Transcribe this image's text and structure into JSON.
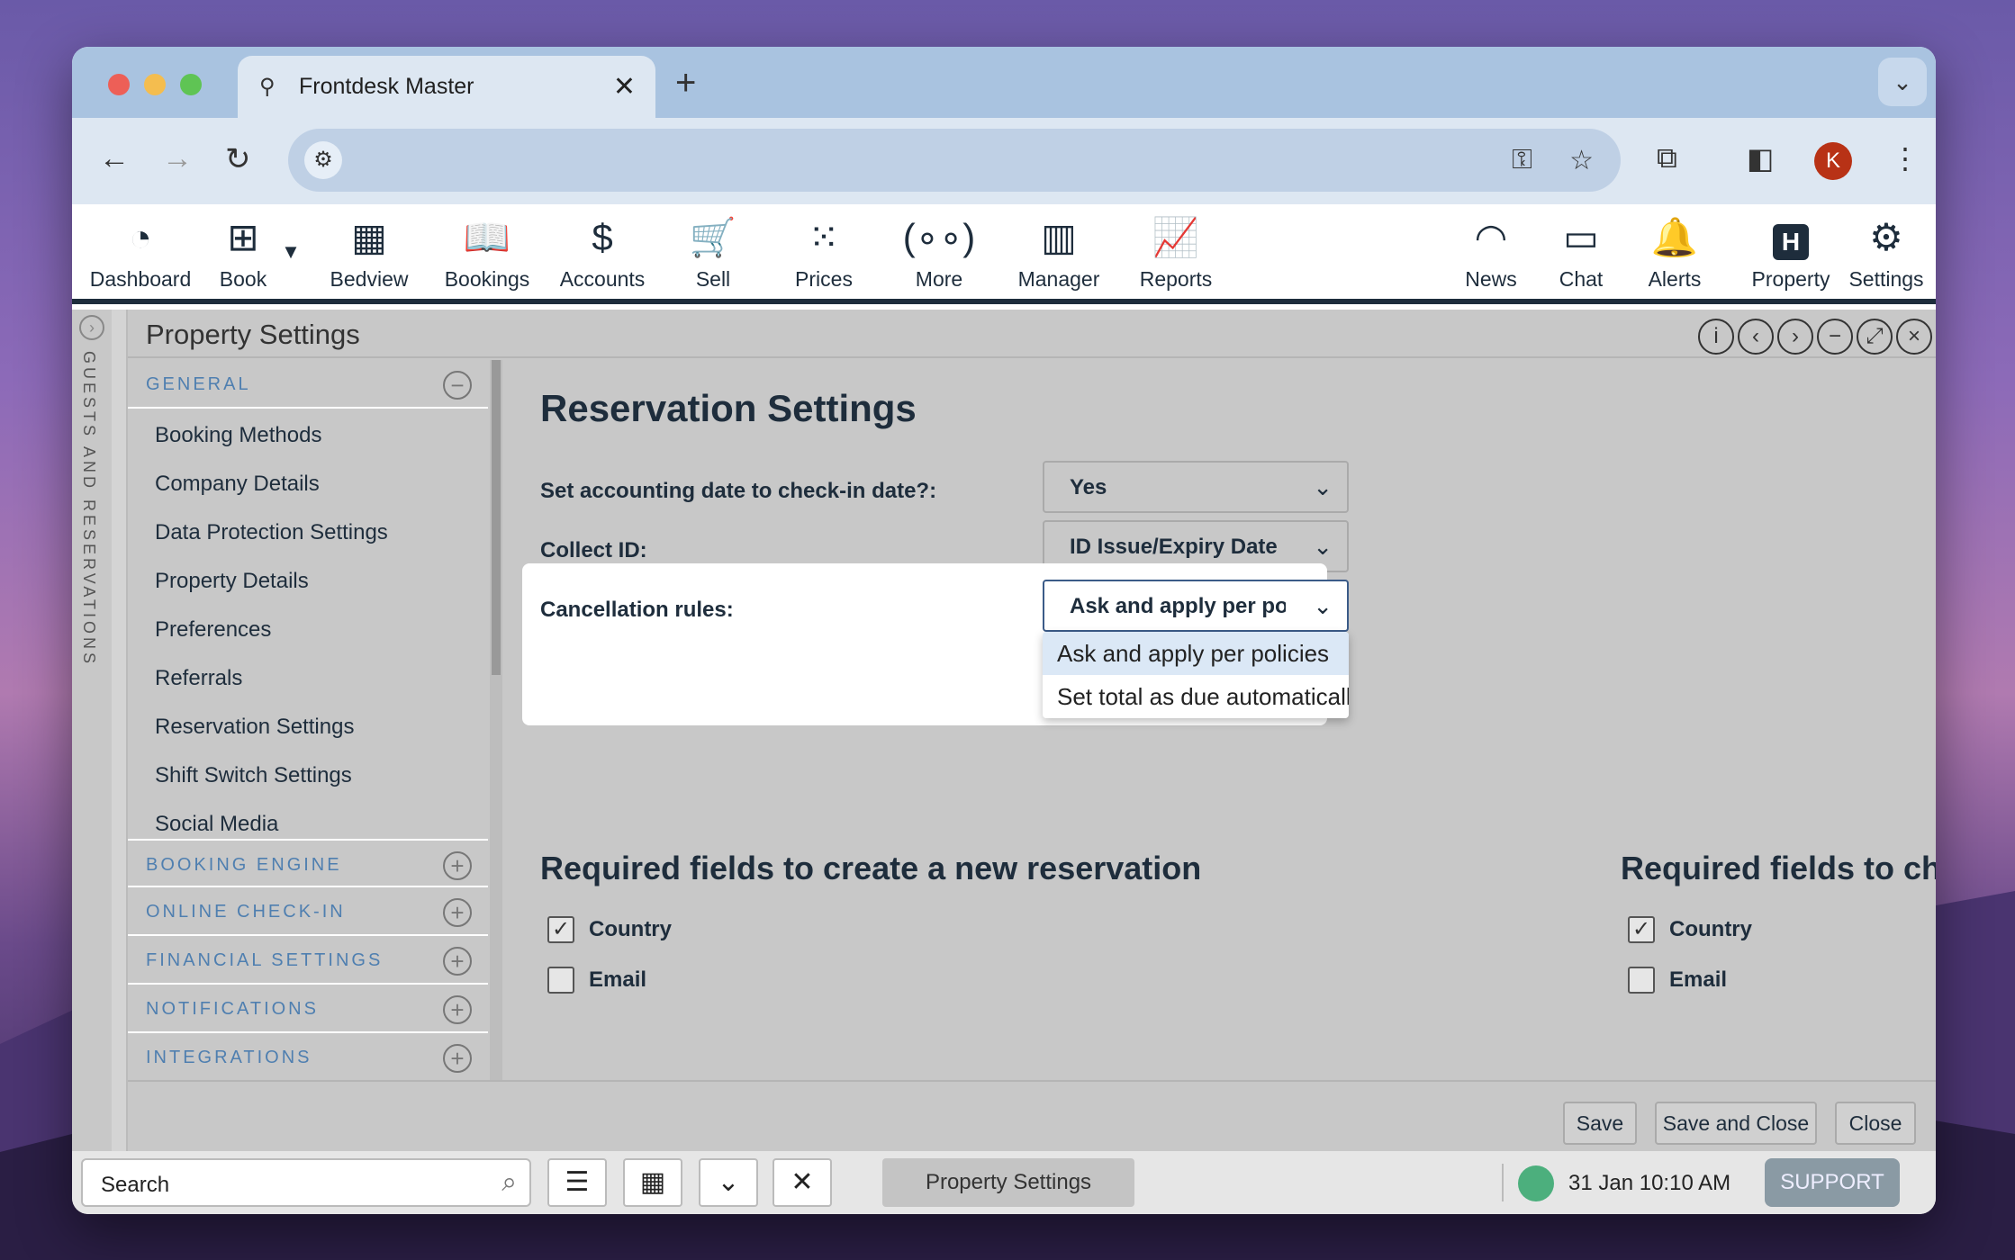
{
  "browser": {
    "tab_title": "Frontdesk Master",
    "new_tab_symbol": "+",
    "avatar_letter": "K"
  },
  "appnav": {
    "items": [
      {
        "label": "Dashboard",
        "icon": "dashboard-gauge-icon"
      },
      {
        "label": "Book",
        "icon": "plus-square-icon"
      },
      {
        "label": "Bedview",
        "icon": "grid-icon"
      },
      {
        "label": "Bookings",
        "icon": "book-open-icon"
      },
      {
        "label": "Accounts",
        "icon": "accounts-dollar-icon"
      },
      {
        "label": "Sell",
        "icon": "cart-icon"
      },
      {
        "label": "Prices",
        "icon": "dots-grid-icon"
      },
      {
        "label": "More",
        "icon": "more-icon"
      },
      {
        "label": "Manager",
        "icon": "building-icon"
      },
      {
        "label": "Reports",
        "icon": "chart-icon"
      },
      {
        "label": "News",
        "icon": "rss-icon"
      },
      {
        "label": "Chat",
        "icon": "chat-icon"
      },
      {
        "label": "Alerts",
        "icon": "bell-icon"
      },
      {
        "label": "Property",
        "icon": "hotel-h-icon"
      },
      {
        "label": "Settings",
        "icon": "gear-icon"
      }
    ]
  },
  "side_strip_label": "GUESTS AND RESERVATIONS",
  "panel": {
    "title": "Property Settings"
  },
  "leftmenu": {
    "general": "GENERAL",
    "items": [
      "Booking Methods",
      "Company Details",
      "Data Protection Settings",
      "Property Details",
      "Preferences",
      "Referrals",
      "Reservation Settings",
      "Shift Switch Settings",
      "Social Media"
    ],
    "sections": [
      "BOOKING ENGINE",
      "ONLINE CHECK-IN",
      "FINANCIAL SETTINGS",
      "NOTIFICATIONS",
      "INTEGRATIONS"
    ]
  },
  "main": {
    "heading": "Reservation Settings",
    "fields": [
      {
        "label": "Set accounting date to check-in date?:",
        "value": "Yes"
      },
      {
        "label": "Collect ID:",
        "value": "ID Issue/Expiry Date"
      },
      {
        "label": "Cancellation rules:",
        "value": "Ask and apply per policies"
      }
    ],
    "dropdown_options": [
      "Ask and apply per policies",
      "Set total as due automatically"
    ],
    "required_new_heading": "Required fields to create a new reservation",
    "required_checkin_heading": "Required fields to check-in",
    "required_new": [
      {
        "label": "Country",
        "checked": true
      },
      {
        "label": "Email",
        "checked": false
      }
    ],
    "required_checkin": [
      {
        "label": "Country",
        "checked": true
      },
      {
        "label": "Email",
        "checked": false
      }
    ],
    "buttons": {
      "save": "Save",
      "save_close": "Save and Close",
      "close": "Close"
    }
  },
  "bottombar": {
    "search": "Search",
    "open_tab": "Property Settings",
    "datetime": "31 Jan 10:10 AM",
    "support": "SUPPORT"
  }
}
